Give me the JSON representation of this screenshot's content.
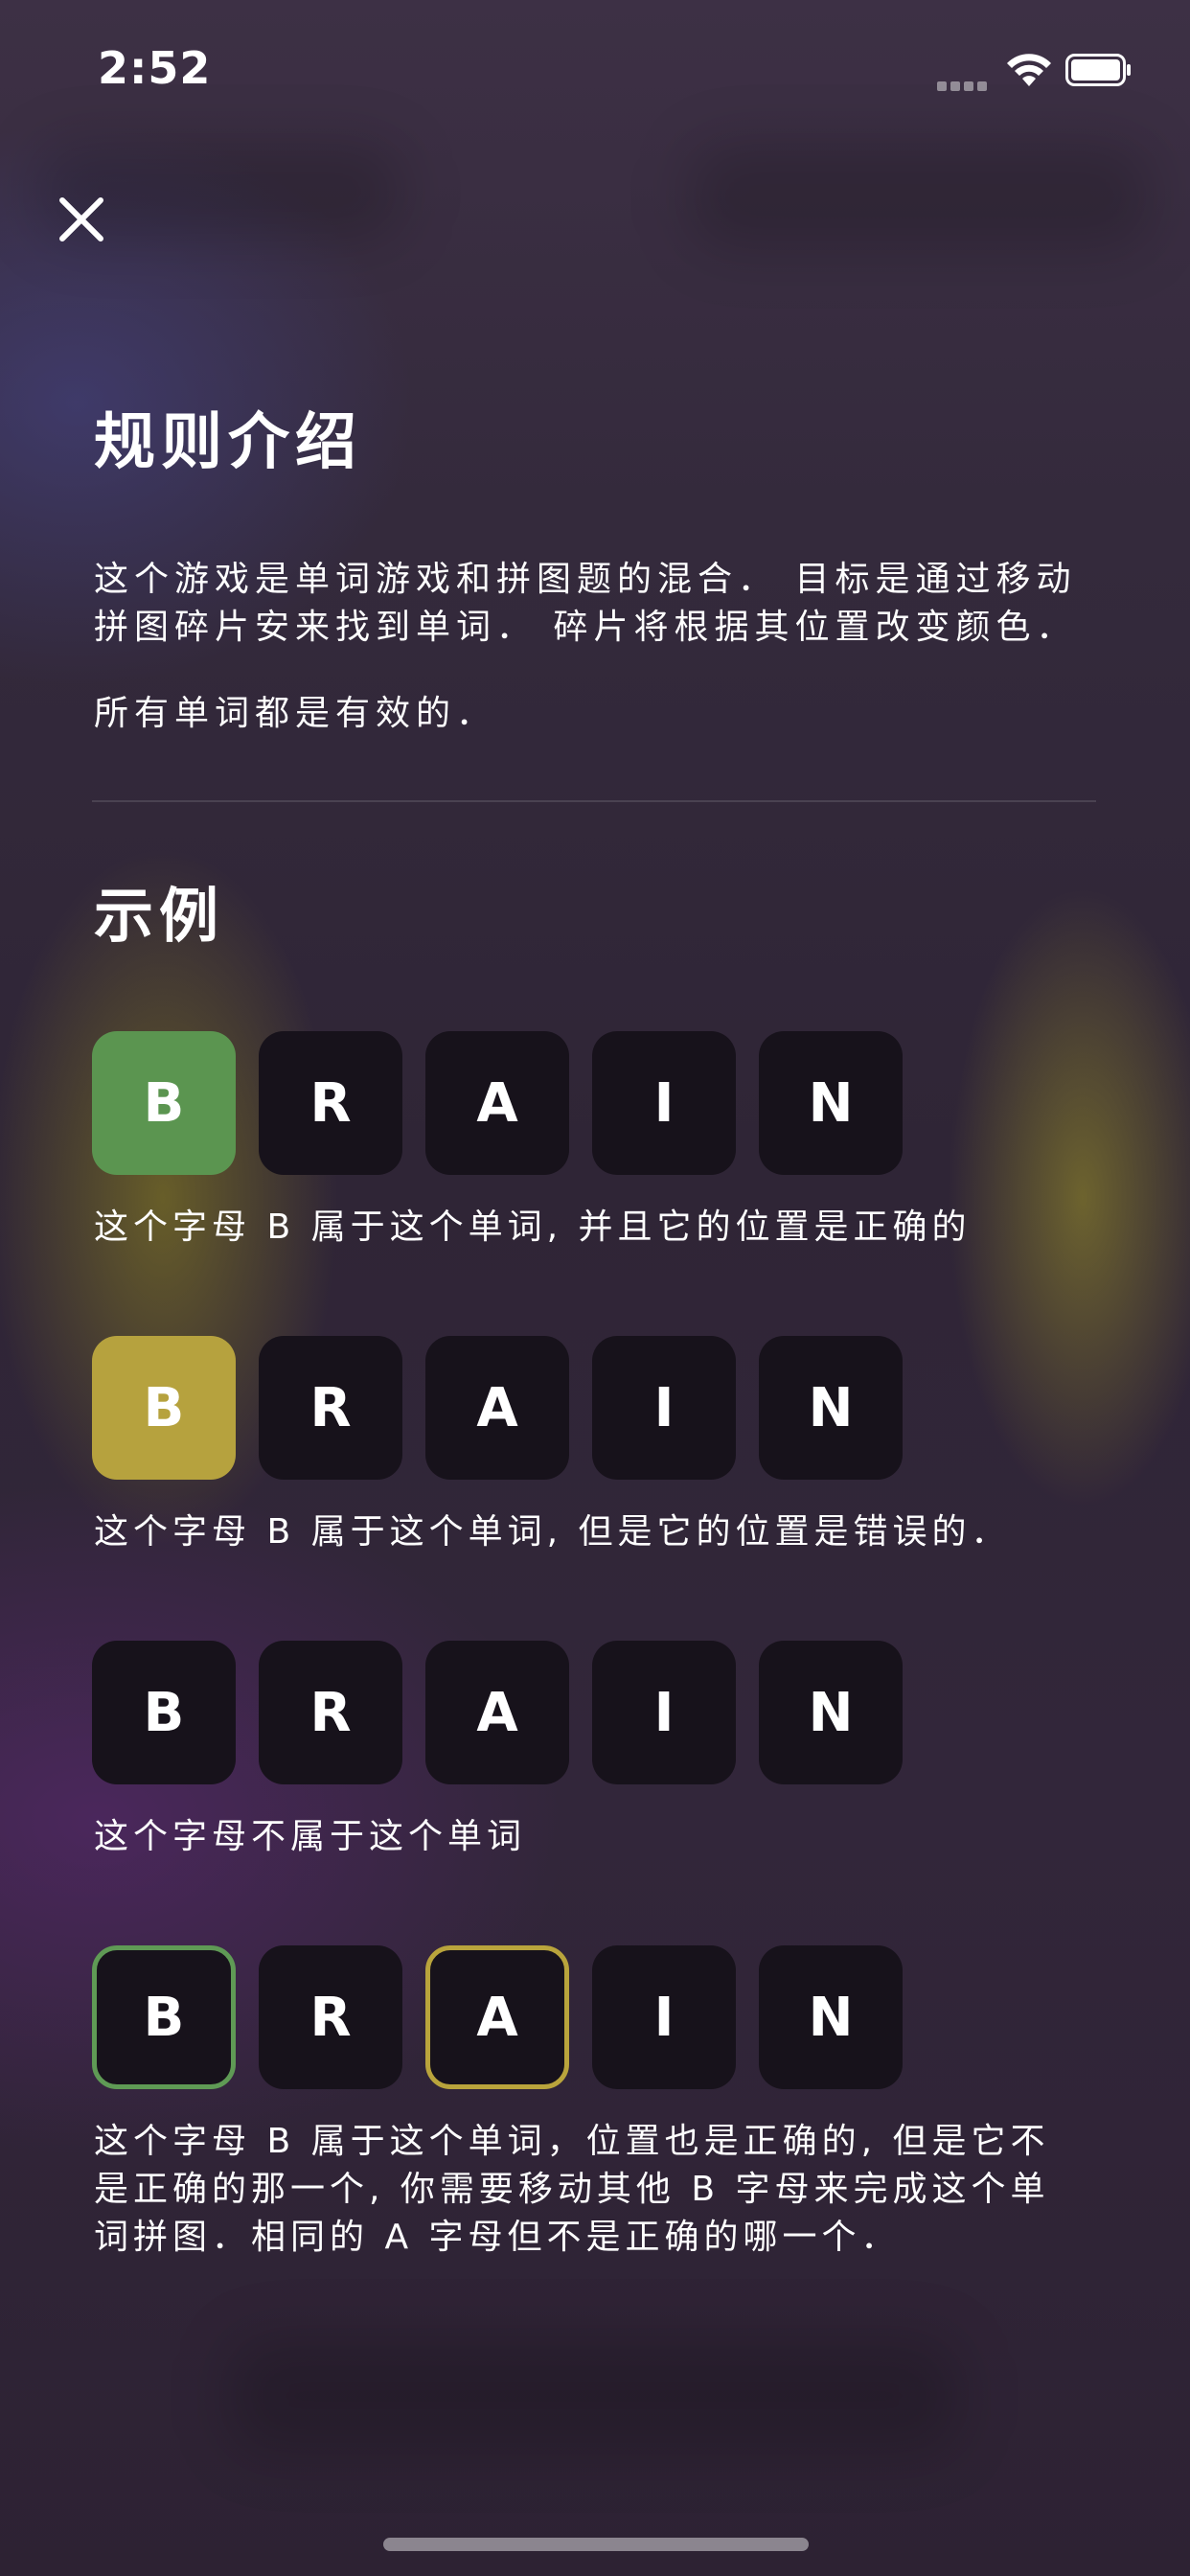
{
  "status_bar": {
    "time": "2:52"
  },
  "title": "规则介绍",
  "intro": {
    "line1": "这个游戏是单词游戏和拼图题的混合． 目标是通过移动",
    "line2": "拼图碎片安来找到单词． 碎片将根据其位置改变颜色．",
    "line3": "所有单词都是有效的．"
  },
  "examples_title": "示例",
  "examples": [
    {
      "tiles": [
        "B",
        "R",
        "A",
        "I",
        "N"
      ],
      "caption_lines": [
        "这个字母 B 属于这个单词, 并且它的位置是正确的"
      ]
    },
    {
      "tiles": [
        "B",
        "R",
        "A",
        "I",
        "N"
      ],
      "caption_lines": [
        "这个字母 B 属于这个单词, 但是它的位置是错误的．"
      ]
    },
    {
      "tiles": [
        "B",
        "R",
        "A",
        "I",
        "N"
      ],
      "caption_lines": [
        "这个字母不属于这个单词"
      ]
    },
    {
      "tiles": [
        "B",
        "R",
        "A",
        "I",
        "N"
      ],
      "caption_lines": [
        "这个字母 B 属于这个单词，位置也是正确的, 但是它不",
        "是正确的那一个, 你需要移动其他 B 字母来完成这个单",
        "词拼图．相同的 A 字母但不是正确的哪一个．"
      ]
    }
  ],
  "colors": {
    "correct": "#5b9550",
    "misplaced": "#b6a23e",
    "tile_bg": "#17121b"
  },
  "icons": {
    "close": "close-icon",
    "wifi": "wifi-icon",
    "battery": "battery-icon",
    "signal": "signal-icon"
  }
}
